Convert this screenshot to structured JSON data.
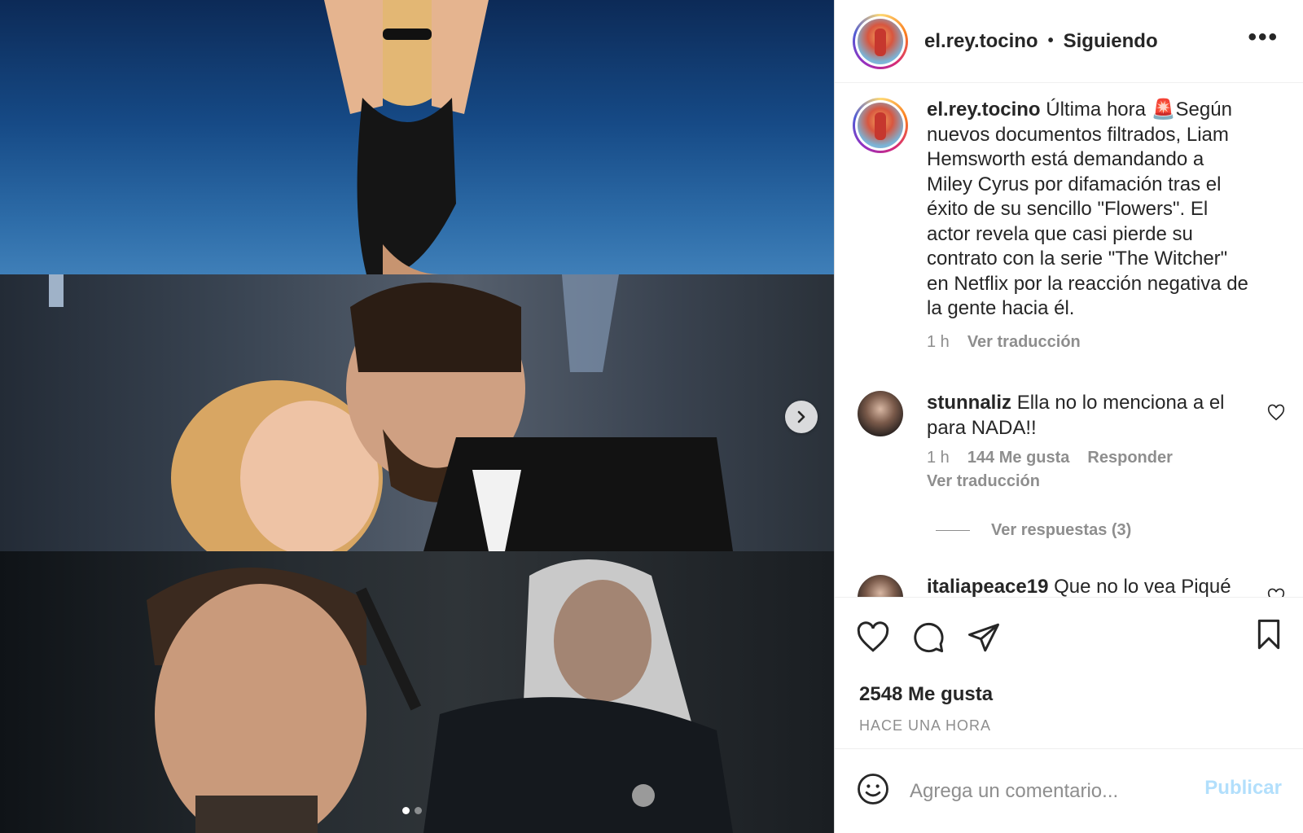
{
  "header": {
    "username": "el.rey.tocino",
    "separator": "•",
    "follow_status": "Siguiendo",
    "more": "•••"
  },
  "caption": {
    "username": "el.rey.tocino",
    "text": "Última hora 🚨Según nuevos documentos filtrados, Liam Hemsworth está demandando a Miley Cyrus por difamación tras el éxito de su sencillo \"Flowers\". El actor revela que casi pierde su contrato con la serie \"The Witcher\" en Netflix por la reacción negativa de la gente hacia él.",
    "time": "1 h",
    "translate": "Ver traducción"
  },
  "comments": [
    {
      "username": "stunnaliz",
      "text": "Ella no lo menciona a el para NADA!!",
      "time": "1 h",
      "likes": "144 Me gusta",
      "reply": "Responder",
      "translate": "Ver traducción",
      "view_replies": "Ver respuestas (3)"
    },
    {
      "username": "italiapeace19",
      "text": "Que no lo vea Piqué"
    }
  ],
  "stats": {
    "likes": "2548 Me gusta",
    "time": "HACE UNA HORA"
  },
  "add_comment": {
    "placeholder": "Agrega un comentario...",
    "publish": "Publicar"
  },
  "carousel": {
    "slide_count": 2,
    "active_slide": 1
  },
  "colors": {
    "publish_disabled": "#b2dffc",
    "secondary_text": "#8e8e8e"
  }
}
